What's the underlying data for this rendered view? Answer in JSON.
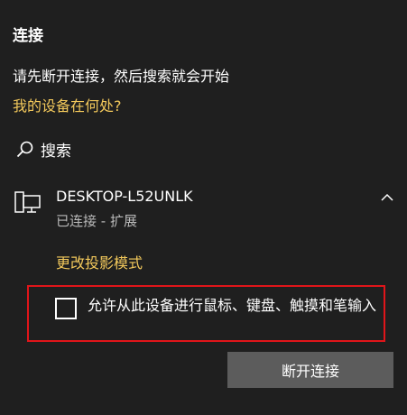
{
  "panel": {
    "title": "连接",
    "instruction": "请先断开连接，然后搜索就会开始",
    "help_link": "我的设备在何处?",
    "search_label": "搜索"
  },
  "device": {
    "name": "DESKTOP-L52UNLK",
    "status": "已连接 - 扩展",
    "icon": "display-icon",
    "expanded": true,
    "change_mode_link": "更改投影模式",
    "allow_input_label": "允许从此设备进行鼠标、键盘、触摸和笔输入",
    "allow_input_checked": false,
    "disconnect_button": "断开连接"
  },
  "colors": {
    "background": "#1f1f1f",
    "link": "#f2c85b",
    "highlight_border": "#e0151a",
    "button_bg": "#5c5c5c"
  }
}
